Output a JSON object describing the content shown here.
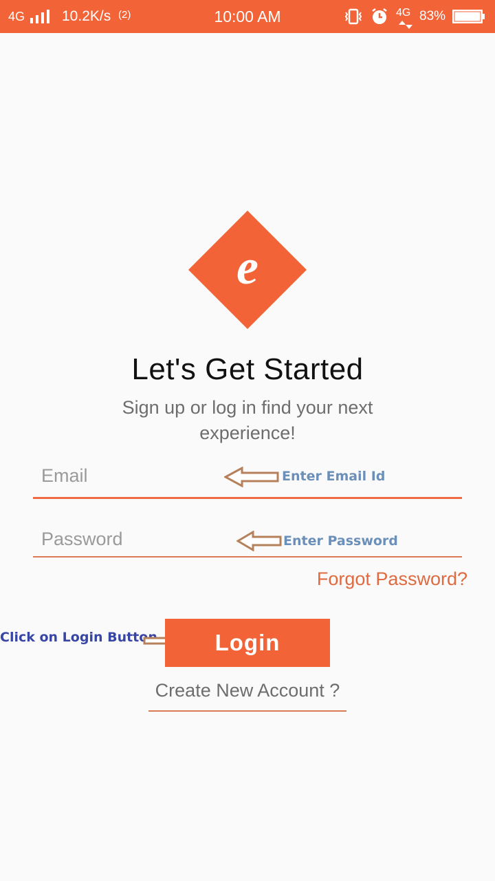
{
  "status_bar": {
    "network": "4G",
    "speed": "10.2K/s",
    "hotspot": "(2)",
    "time": "10:00 AM",
    "network_secondary": "4G",
    "battery": "83%",
    "icons": [
      "signal-bars-icon",
      "hotspot-icon",
      "vibrate-icon",
      "alarm-icon",
      "battery-icon"
    ]
  },
  "brand": {
    "logo_letter": "e",
    "accent_color": "#f26437"
  },
  "heading": {
    "title": "Let's Get Started",
    "subtitle": "Sign up or log in find your next experience!"
  },
  "form": {
    "email_placeholder": "Email",
    "email_value": "",
    "password_placeholder": "Password",
    "password_value": "",
    "forgot_label": "Forgot Password?",
    "login_label": "Login",
    "create_account_label": "Create New Account ?"
  },
  "annotations": {
    "email_hint": "Enter Email Id",
    "password_hint": "Enter Password",
    "login_hint": "Click on Login Button",
    "arrow_color": "#b5805a"
  }
}
